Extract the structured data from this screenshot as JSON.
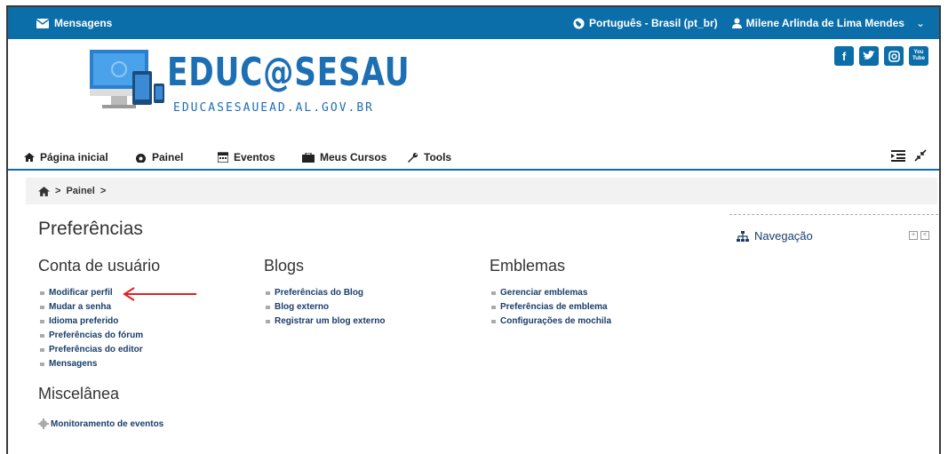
{
  "topbar": {
    "messages_label": "Mensagens",
    "language_label": "Português - Brasil (pt_br)",
    "user_name": "Milene Arlinda de Lima Mendes"
  },
  "header": {
    "logo_title": "EDUC@SESAU",
    "logo_subtitle": "EDUCASESAUEAD.AL.GOV.BR",
    "social_icons": [
      "facebook-icon",
      "twitter-icon",
      "instagram-icon",
      "youtube-icon"
    ],
    "youtube_label": "You Tube"
  },
  "nav": {
    "items": [
      {
        "label": "Página inicial",
        "icon": "home-icon"
      },
      {
        "label": "Painel",
        "icon": "dashboard-icon"
      },
      {
        "label": "Eventos",
        "icon": "calendar-icon"
      },
      {
        "label": "Meus Cursos",
        "icon": "briefcase-icon"
      },
      {
        "label": "Tools",
        "icon": "wrench-icon"
      }
    ]
  },
  "breadcrumb": {
    "items": [
      "Painel"
    ]
  },
  "page": {
    "title": "Preferências"
  },
  "sections": {
    "account": {
      "title": "Conta de usuário",
      "links": [
        "Modificar perfil",
        "Mudar a senha",
        "Idioma preferido",
        "Preferências do fórum",
        "Preferências do editor",
        "Mensagens"
      ]
    },
    "blogs": {
      "title": "Blogs",
      "links": [
        "Preferências do Blog",
        "Blog externo",
        "Registrar um blog externo"
      ]
    },
    "badges": {
      "title": "Emblemas",
      "links": [
        "Gerenciar emblemas",
        "Preferências de emblema",
        "Configurações de mochila"
      ]
    },
    "misc": {
      "title": "Miscelânea",
      "links": [
        "Monitoramento de eventos"
      ]
    }
  },
  "block": {
    "navigation_title": "Navegação"
  },
  "colors": {
    "primary": "#0b6ea8",
    "link": "#1a3e6b",
    "arrow": "#e02020"
  }
}
